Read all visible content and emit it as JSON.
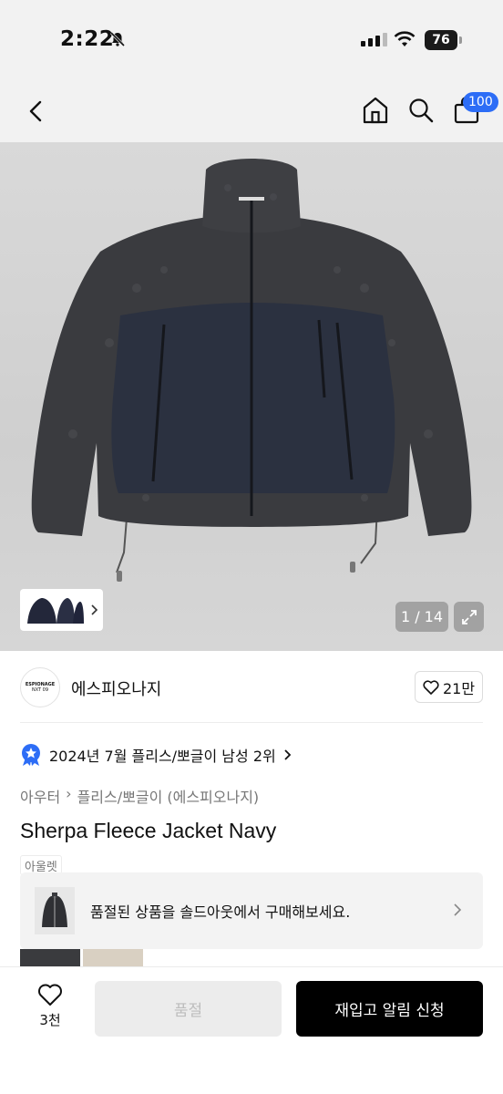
{
  "status_bar": {
    "time": "2:22",
    "battery": "76"
  },
  "header": {
    "cart_count": "100"
  },
  "gallery": {
    "counter": "1 / 14"
  },
  "brand": {
    "logo_line1": "ESPIONAGE",
    "logo_line2": "NXT 09",
    "name": "에스피오나지",
    "likes": "21만"
  },
  "ranking": {
    "text": "2024년 7월 플리스/뽀글이 남성 2위"
  },
  "breadcrumb": {
    "category": "아우터",
    "subcategory": "플리스/뽀글이 (에스피오나지)"
  },
  "product": {
    "title": "Sherpa Fleece Jacket Navy",
    "tag": "아울렛"
  },
  "soldout_banner": {
    "text": "품절된 상품을 솔드아웃에서 구매해보세요."
  },
  "bottom": {
    "wish_count": "3천",
    "soldout_label": "품절",
    "restock_label": "재입고 알림 신청"
  },
  "colors": {
    "accent": "#2d6df6",
    "jacket_fleece": "#3a3b3f",
    "jacket_panel": "#2b3140"
  }
}
